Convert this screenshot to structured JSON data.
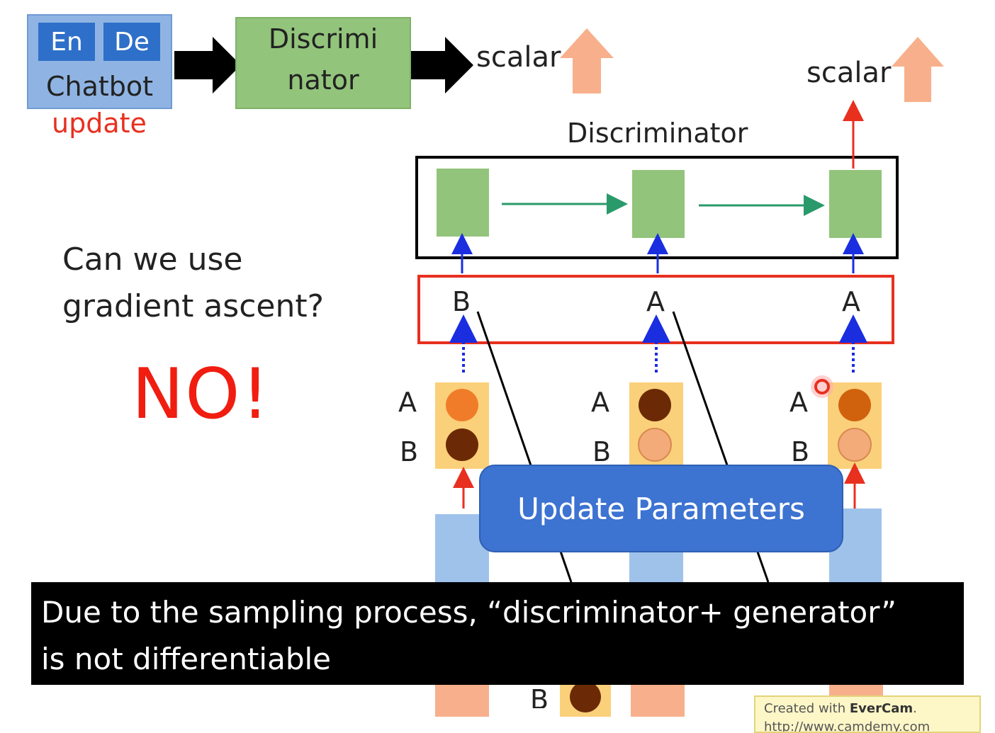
{
  "chatbot": {
    "en": "En",
    "de": "De",
    "label": "Chatbot",
    "update": "update"
  },
  "discriminator_block": {
    "line1": "Discrimi",
    "line2": "nator"
  },
  "scalar_left": "scalar",
  "scalar_right": "scalar",
  "discriminator_title": "Discriminator",
  "question": {
    "line1": "Can we use",
    "line2": "gradient ascent?"
  },
  "answer": "NO!",
  "sampled_tokens": [
    "B",
    "A",
    "A"
  ],
  "distribution_labels": [
    {
      "top": "A",
      "bottom": "B"
    },
    {
      "top": "A",
      "bottom": "B"
    },
    {
      "top": "A",
      "bottom": "B"
    }
  ],
  "hidden_token": "B",
  "update_button": "Update Parameters",
  "caption": {
    "line1": "Due to the sampling process, “discriminator+ generator”",
    "line2": "is not differentiable"
  },
  "watermark": {
    "prefix": "Created with ",
    "brand": "EverCam",
    "suffix": ".",
    "url": "http://www.camdemy.com"
  },
  "colors": {
    "chatbot_bg": "#8fb4e3",
    "token_bg": "#2e6fc9",
    "disc_green": "#92c47b",
    "arrow_orange": "#f8b08c",
    "red": "#e8301f",
    "caption_bg": "#000000",
    "button_blue": "#3d73d1"
  }
}
